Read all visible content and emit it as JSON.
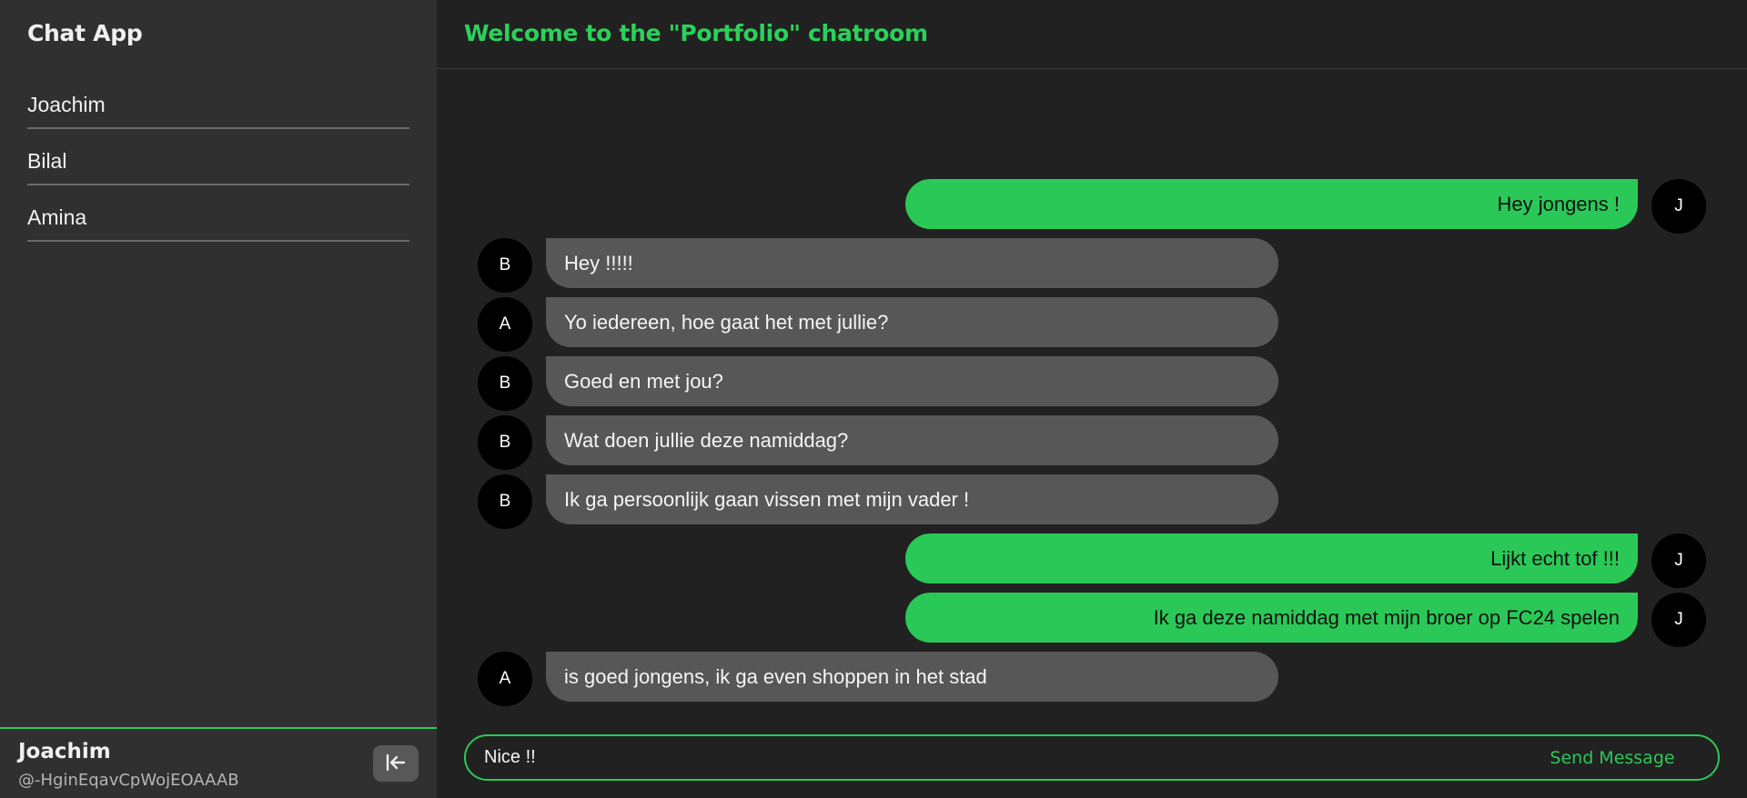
{
  "sidebar": {
    "app_title": "Chat App",
    "users": [
      "Joachim",
      "Bilal",
      "Amina"
    ],
    "current_user": {
      "name": "Joachim",
      "handle": "@-HginEqavCpWojEOAAAB"
    },
    "collapse_icon": "collapse-left-arrow-icon"
  },
  "chat": {
    "title": "Welcome to the \"Portfolio\" chatroom",
    "messages": [
      {
        "side": "right",
        "avatar": "J",
        "text": "Hey jongens !"
      },
      {
        "side": "left",
        "avatar": "B",
        "text": "Hey !!!!!"
      },
      {
        "side": "left",
        "avatar": "A",
        "text": "Yo iedereen, hoe gaat het met jullie?"
      },
      {
        "side": "left",
        "avatar": "B",
        "text": "Goed en met jou?"
      },
      {
        "side": "left",
        "avatar": "B",
        "text": "Wat doen jullie deze namiddag?"
      },
      {
        "side": "left",
        "avatar": "B",
        "text": "Ik ga persoonlijk gaan vissen met mijn vader !"
      },
      {
        "side": "right",
        "avatar": "J",
        "text": "Lijkt echt tof !!!"
      },
      {
        "side": "right",
        "avatar": "J",
        "text": "Ik ga deze namiddag met mijn broer op FC24 spelen"
      },
      {
        "side": "left",
        "avatar": "A",
        "text": "is goed jongens, ik ga even shoppen in het stad"
      }
    ]
  },
  "composer": {
    "value": "Nice !!",
    "send_label": "Send Message"
  },
  "colors": {
    "accent": "#2ac957",
    "sidebar_bg": "#303030",
    "main_bg": "#212121",
    "incoming_bubble": "#575757"
  }
}
